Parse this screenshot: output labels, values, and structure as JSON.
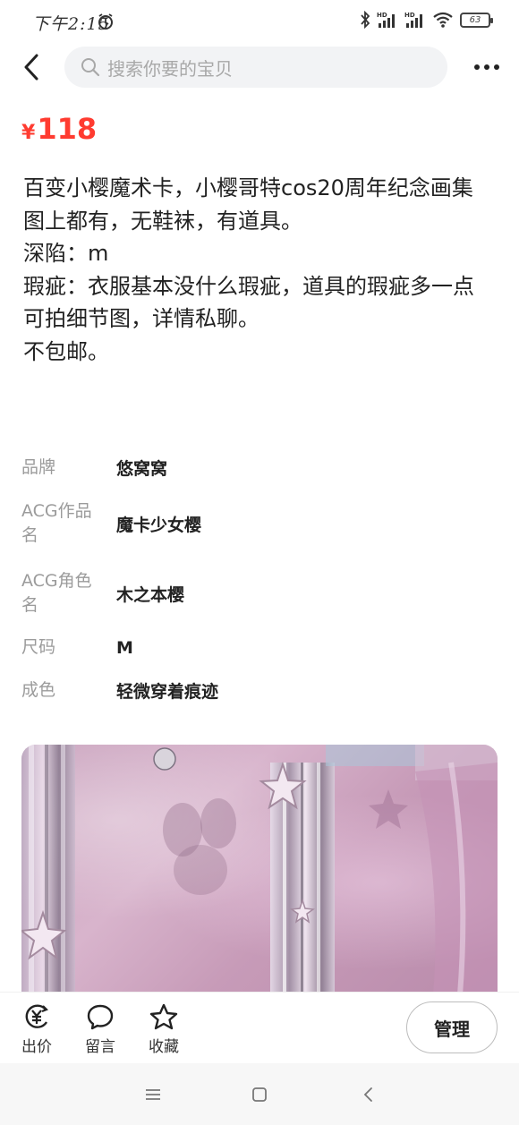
{
  "status_bar": {
    "time": "下午2:15",
    "battery_level": "63",
    "icons": [
      "alarm-icon",
      "bluetooth-icon",
      "signal-hd-icon",
      "signal-hd-icon",
      "wifi-icon",
      "battery-icon"
    ]
  },
  "nav": {
    "search_placeholder": "搜索你要的宝贝",
    "icons": [
      "back-arrow-icon",
      "search-icon",
      "more-dots-icon"
    ]
  },
  "price": {
    "symbol": "¥",
    "value": "118",
    "color": "#ff3b30"
  },
  "description": {
    "lines": [
      "百变小樱魔术卡，小樱哥特cos20周年纪念画集",
      "图上都有，无鞋袜，有道具。",
      "深陷：m",
      "瑕疵：衣服基本没什么瑕疵，道具的瑕疵多一点",
      "可拍细节图，详情私聊。",
      "不包邮。"
    ]
  },
  "attributes": [
    {
      "key": "品牌",
      "value": "悠窝窝"
    },
    {
      "key": "ACG作品名",
      "value": "魔卡少女樱"
    },
    {
      "key": "ACG角色名",
      "value": "木之本樱"
    },
    {
      "key": "尺码",
      "value": "M"
    },
    {
      "key": "成色",
      "value": "轻微穿着痕迹"
    }
  ],
  "actions": {
    "bid_label": "出价",
    "comment_label": "留言",
    "favorite_label": "收藏",
    "manage_label": "管理"
  },
  "system_nav": {
    "icons": [
      "menu-icon",
      "home-icon",
      "back-icon"
    ]
  }
}
